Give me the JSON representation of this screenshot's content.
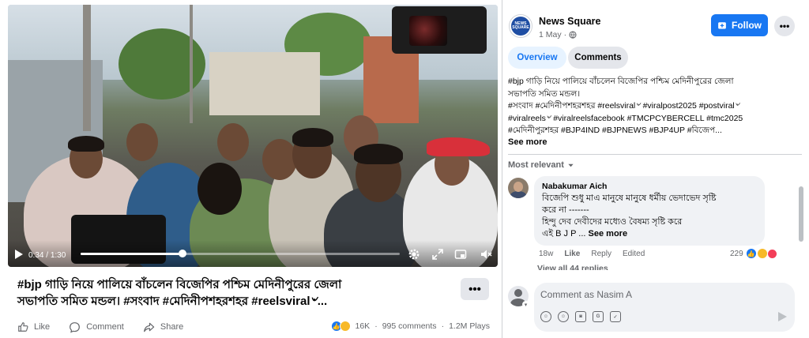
{
  "video": {
    "current_time": "0:34",
    "duration": "1:30",
    "progress_fraction": 0.32
  },
  "post": {
    "title_line1": "#bjp গাড়ি নিয়ে পালিয়ে বাঁচলেন বিজেপির পশ্চিম মেদিনীপুরের জেলা",
    "title_line2": "সভাপতি সমিত মন্ডল। #সংবাদ #মেদিনীপশহরশহর #reelsviral৺...",
    "more_label": "•••",
    "actions": {
      "like": "Like",
      "comment": "Comment",
      "share": "Share"
    },
    "reactions_count": "16K",
    "comments_count": "995 comments",
    "plays_count": "1.2M Plays"
  },
  "page": {
    "name": "News Square",
    "avatar_text": "NEWS SQUARE",
    "date": "1 May",
    "follow_label": "Follow",
    "dots_label": "•••"
  },
  "tabs": {
    "overview": "Overview",
    "comments": "Comments"
  },
  "description": {
    "line1": "#bjp গাড়ি নিয়ে পালিয়ে বাঁচলেন বিজেপির পশ্চিম মেদিনীপুরের জেলা",
    "line2": "সভাপতি সমিত মন্ডল।",
    "line3": "#সংবাদ #মেদিনীপশহরশহর #reelsviral৺ #viralpost2025 #postviral৺",
    "line4": "#viralreels৺ #viralreelsfacebook #TMCPCYBERCELL #tmc2025",
    "line5": "#মেদিনীপুরশহর #BJP4IND #BJPNEWS #BJP4UP #বিজেপ...",
    "see_more": "See more"
  },
  "comments_section": {
    "sort_label": "Most relevant",
    "comment": {
      "author": "Nabakumar Aich",
      "line1": "বিজেপি শুধু মাএ মানুষে মানুষে ধর্মীয় ভেদাভেদ সৃষ্টি",
      "line2": "করে না -------",
      "line3": "হিন্দু দেব দেবীদের মধ্যেও বৈষম্য সৃষ্টি করে",
      "line4": "এই B J P ...",
      "see_more": "See more",
      "age": "18w",
      "like": "Like",
      "reply": "Reply",
      "edited": "Edited",
      "reaction_count": "229"
    },
    "view_replies": "View all 44 replies"
  },
  "composer": {
    "placeholder": "Comment as Nasim A"
  },
  "colors": {
    "accent": "#1877f2",
    "tab_active_bg": "#e7f3ff",
    "secondary_text": "#65676b",
    "bubble_bg": "#f0f2f5"
  }
}
